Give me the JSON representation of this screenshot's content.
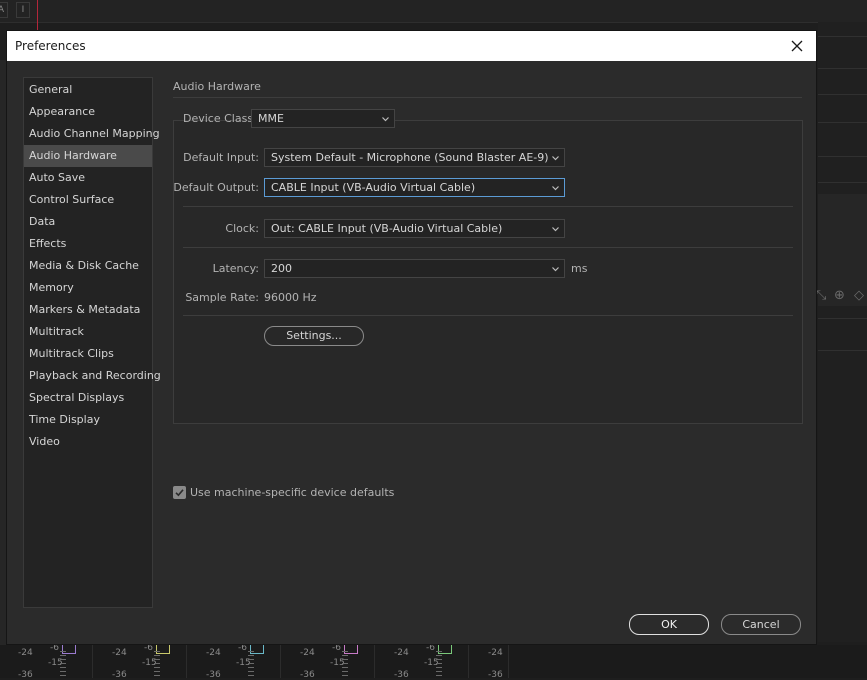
{
  "background": {
    "tool_labels": [
      "A",
      "I"
    ],
    "mixer_strips": [
      {
        "db_top": "-24",
        "db_mid": "-15",
        "db_low": "-36",
        "fader_mark": "-6",
        "cap_color": "#9b7bd0"
      },
      {
        "db_top": "-24",
        "db_mid": "-15",
        "db_low": "-36",
        "fader_mark": "-6",
        "cap_color": "#c8c86a"
      },
      {
        "db_top": "-24",
        "db_mid": "-15",
        "db_low": "-36",
        "fader_mark": "-6",
        "cap_color": "#6ab8c8"
      },
      {
        "db_top": "-24",
        "db_mid": "-15",
        "db_low": "-36",
        "fader_mark": "-6",
        "cap_color": "#c87ac8"
      },
      {
        "db_top": "-24",
        "db_mid": "-15",
        "db_low": "-36",
        "fader_mark": "-6",
        "cap_color": "#7ac87a"
      },
      {
        "db_top": "-24",
        "db_mid": "",
        "db_low": "-36",
        "fader_mark": "",
        "cap_color": ""
      }
    ]
  },
  "dialog": {
    "title": "Preferences",
    "close_icon": "close-icon"
  },
  "sidebar": {
    "selected": "Audio Hardware",
    "items": [
      {
        "label": "General"
      },
      {
        "label": "Appearance"
      },
      {
        "label": "Audio Channel Mapping"
      },
      {
        "label": "Audio Hardware"
      },
      {
        "label": "Auto Save"
      },
      {
        "label": "Control Surface"
      },
      {
        "label": "Data"
      },
      {
        "label": "Effects"
      },
      {
        "label": "Media & Disk Cache"
      },
      {
        "label": "Memory"
      },
      {
        "label": "Markers & Metadata"
      },
      {
        "label": "Multitrack"
      },
      {
        "label": "Multitrack Clips"
      },
      {
        "label": "Playback and Recording"
      },
      {
        "label": "Spectral Displays"
      },
      {
        "label": "Time Display"
      },
      {
        "label": "Video"
      }
    ]
  },
  "panel": {
    "title": "Audio Hardware",
    "device_class": {
      "label": "Device Class:",
      "value": "MME"
    },
    "default_input": {
      "label": "Default Input:",
      "value": "System Default - Microphone (Sound Blaster AE-9)"
    },
    "default_output": {
      "label": "Default Output:",
      "value": "CABLE Input (VB-Audio Virtual Cable)"
    },
    "clock": {
      "label": "Clock:",
      "value": "Out: CABLE Input (VB-Audio Virtual Cable)"
    },
    "latency": {
      "label": "Latency:",
      "value": "200",
      "unit": "ms"
    },
    "sample_rate": {
      "label": "Sample Rate:",
      "value": "96000 Hz"
    },
    "settings_button": "Settings...",
    "machine_defaults": {
      "label": "Use machine-specific device defaults",
      "checked": true
    }
  },
  "footer": {
    "ok": "OK",
    "cancel": "Cancel"
  },
  "colors": {
    "focus_border": "#5b9bd5",
    "selected_item": "#4a4a4a",
    "dialog_bg": "#2b2b2b",
    "app_red_marker": "#b3263a"
  }
}
